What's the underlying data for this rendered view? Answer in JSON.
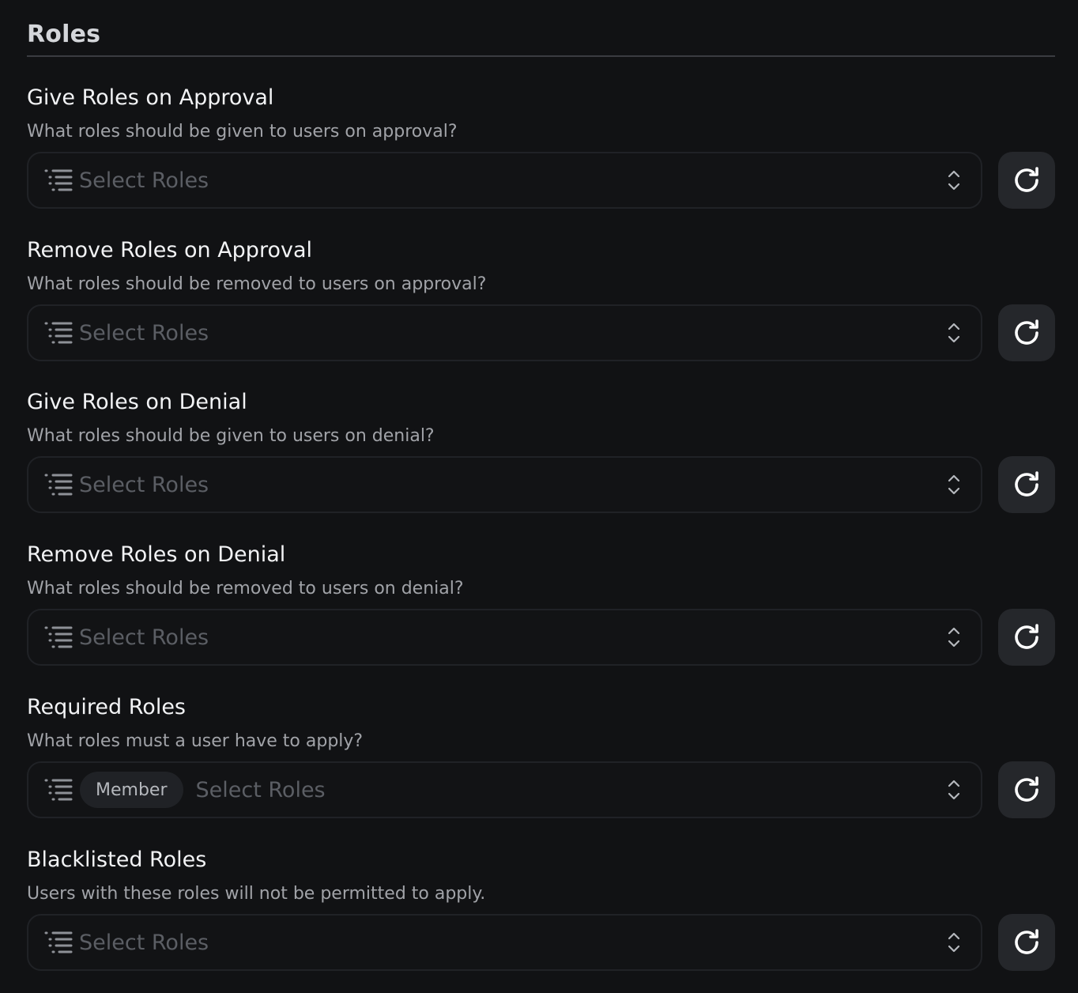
{
  "section": {
    "title": "Roles"
  },
  "fields": [
    {
      "title": "Give Roles on Approval",
      "description": "What roles should be given to users on approval?",
      "placeholder": "Select Roles",
      "selected": []
    },
    {
      "title": "Remove Roles on Approval",
      "description": "What roles should be removed to users on approval?",
      "placeholder": "Select Roles",
      "selected": []
    },
    {
      "title": "Give Roles on Denial",
      "description": "What roles should be given to users on denial?",
      "placeholder": "Select Roles",
      "selected": []
    },
    {
      "title": "Remove Roles on Denial",
      "description": "What roles should be removed to users on denial?",
      "placeholder": "Select Roles",
      "selected": []
    },
    {
      "title": "Required Roles",
      "description": "What roles must a user have to apply?",
      "placeholder": "Select Roles",
      "selected": [
        "Member"
      ]
    },
    {
      "title": "Blacklisted Roles",
      "description": "Users with these roles will not be permitted to apply.",
      "placeholder": "Select Roles",
      "selected": []
    }
  ],
  "icons": {
    "select_leading": "list-icon",
    "select_trailing": "chevron-up-down-icon",
    "reset": "refresh-icon"
  },
  "colors": {
    "background": "#111214",
    "input_border": "#202226",
    "button_bg": "#25272b",
    "chip_bg": "#202226",
    "title_text": "#f2f3f5",
    "description_text": "#a1a3a8",
    "placeholder_text": "#5b5e64"
  }
}
